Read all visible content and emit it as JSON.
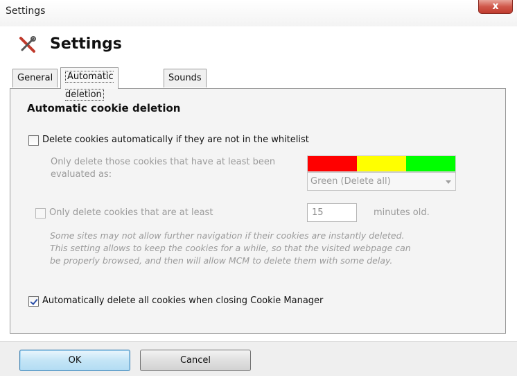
{
  "window": {
    "title": "Settings",
    "close_label": "x"
  },
  "header": {
    "title": "Settings",
    "icon": "tools-icon"
  },
  "tabs": [
    {
      "label": "General",
      "active": false
    },
    {
      "label": "Automatic deletion",
      "active": true
    },
    {
      "label": "Sounds",
      "active": false
    }
  ],
  "section": {
    "title": "Automatic cookie deletion",
    "delete_not_whitelisted": {
      "label": "Delete cookies automatically if they are not in the whitelist",
      "checked": false
    },
    "evaluation_text_line1": "Only delete those cookies that have at least been",
    "evaluation_text_line2": "evaluated as:",
    "rating_colors": [
      "#ff0000",
      "#ffff00",
      "#00ff00"
    ],
    "rating_select": {
      "value": "Green (Delete all)"
    },
    "min_age": {
      "label": "Only delete cookies that are at least",
      "checked": false,
      "value": "15",
      "unit": "minutes old."
    },
    "note_line1": "Some sites may not allow further navigation if their cookies are instantly deleted.",
    "note_line2": "This setting allows to keep the cookies for a while, so that the visited webpage can",
    "note_line3": "be properly browsed, and then will allow MCM to delete them with some delay.",
    "delete_on_close": {
      "label": "Automatically delete all cookies when closing Cookie Manager",
      "checked": true
    }
  },
  "footer": {
    "ok_label": "OK",
    "cancel_label": "Cancel"
  }
}
